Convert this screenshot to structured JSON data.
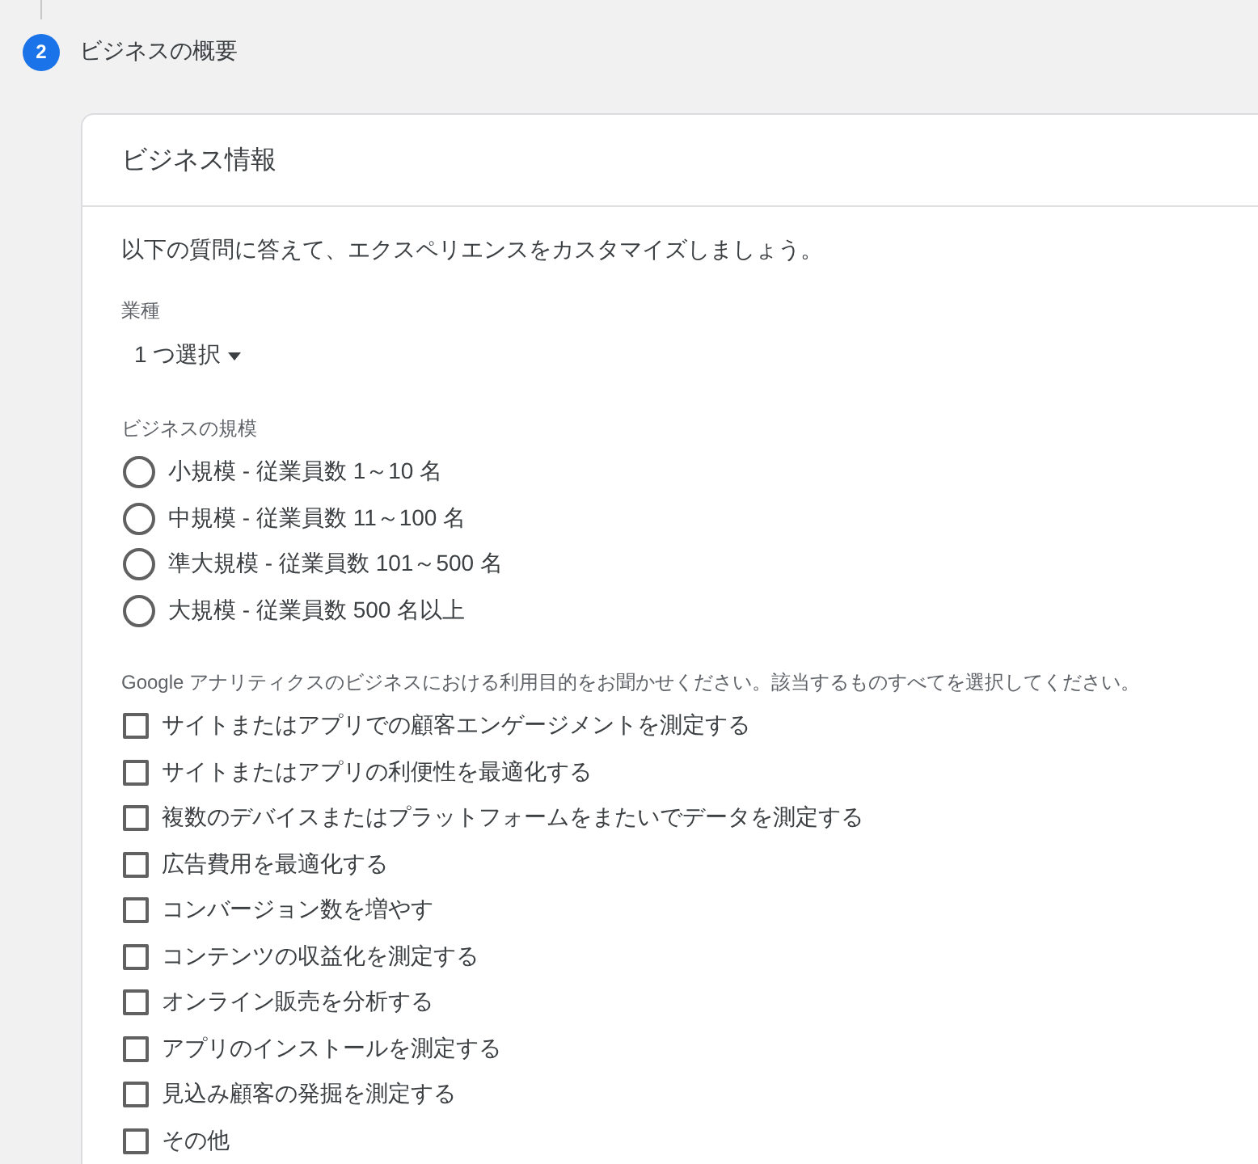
{
  "step": {
    "number": "2",
    "label": "ビジネスの概要",
    "active": true
  },
  "card": {
    "title": "ビジネス情報",
    "intro": "以下の質問に答えて、エクスペリエンスをカスタマイズしましょう。",
    "industry": {
      "label": "業種",
      "value": "1 つ選択"
    },
    "size": {
      "label": "ビジネスの規模",
      "options": [
        {
          "label": "小規模 - 従業員数 1～10 名",
          "selected": false
        },
        {
          "label": "中規模 - 従業員数 11～100 名",
          "selected": false
        },
        {
          "label": "準大規模 - 従業員数 101～500 名",
          "selected": false
        },
        {
          "label": "大規模 - 従業員数 500 名以上",
          "selected": false
        }
      ]
    },
    "purposes": {
      "label": "Google アナリティクスのビジネスにおける利用目的をお聞かせください。該当するものすべてを選択してください。",
      "options": [
        {
          "label": "サイトまたはアプリでの顧客エンゲージメントを測定する",
          "checked": false
        },
        {
          "label": "サイトまたはアプリの利便性を最適化する",
          "checked": false
        },
        {
          "label": "複数のデバイスまたはプラットフォームをまたいでデータを測定する",
          "checked": false
        },
        {
          "label": "広告費用を最適化する",
          "checked": false
        },
        {
          "label": "コンバージョン数を増やす",
          "checked": false
        },
        {
          "label": "コンテンツの収益化を測定する",
          "checked": false
        },
        {
          "label": "オンライン販売を分析する",
          "checked": false
        },
        {
          "label": "アプリのインストールを測定する",
          "checked": false
        },
        {
          "label": "見込み顧客の発掘を測定する",
          "checked": false
        },
        {
          "label": "その他",
          "checked": false
        }
      ]
    }
  }
}
